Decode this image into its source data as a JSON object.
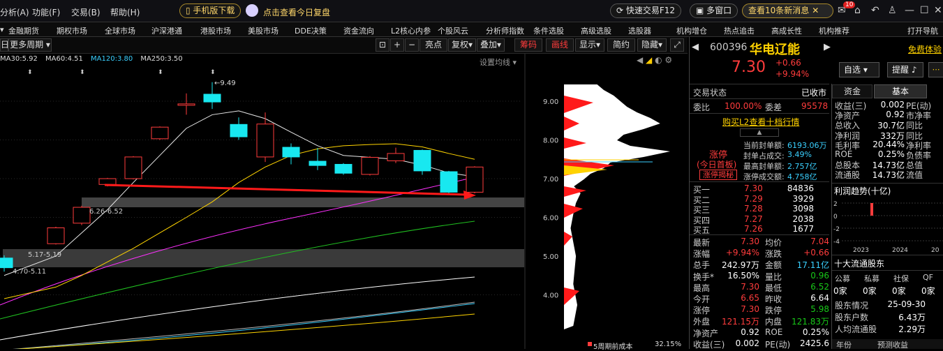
{
  "menu": {
    "items": [
      "分析(A)",
      "功能(F)",
      "交易(B)",
      "帮助(H)"
    ]
  },
  "top": {
    "mobile_btn": "手机版下载",
    "replay_btn": "点击查看今日复盘",
    "quick_trade": "快速交易F12",
    "multi_window": "多窗口",
    "news": "查看10条新消息",
    "news_badge": "10"
  },
  "nav": {
    "items": [
      "金融期货",
      "期权市场",
      "全球市场",
      "沪深港通",
      "港股市场",
      "美股市场",
      "DDE决策",
      "资金流向",
      "L2核心内参",
      "个股风云",
      "分析师指数",
      "条件选股",
      "高级选股",
      "选股器",
      "机构增仓",
      "热点追击",
      "高成长性",
      "机构推荐",
      "打开导航"
    ]
  },
  "toolbar": {
    "period": "日",
    "more_period": "更多周期",
    "buttons": [
      "亮点",
      "复权",
      "叠加",
      "筹码",
      "画线",
      "显示",
      "简约",
      "隐藏"
    ],
    "setting_ma": "设置均线"
  },
  "ma_legend": [
    {
      "label": "MA30:5.92",
      "color": "#f0f0f0"
    },
    {
      "label": "MA60:4.51",
      "color": "#ffffff"
    },
    {
      "label": "MA120:3.80",
      "color": "#3ad0ff"
    },
    {
      "label": "MA250:3.50",
      "color": "#f0f0f0"
    }
  ],
  "chart_data": {
    "type": "candlestick",
    "y_ticks": [
      "9.00",
      "8.00",
      "7.00",
      "6.00",
      "5.00",
      "4.00"
    ],
    "annotations": {
      "high": "9.49",
      "range1": "6.26-6.52",
      "range2": "5.17-5.19",
      "range3": "4.70-5.11"
    },
    "candles": [
      {
        "o": 4.95,
        "c": 4.7,
        "h": 5.02,
        "l": 4.6
      },
      {
        "o": 5.32,
        "c": 5.73,
        "h": 5.76,
        "l": 5.3
      },
      {
        "o": 5.85,
        "c": 6.26,
        "h": 6.3,
        "l": 5.8
      },
      {
        "o": 6.85,
        "c": 7.0,
        "h": 7.02,
        "l": 6.8
      },
      {
        "o": 7.0,
        "c": 7.56,
        "h": 7.58,
        "l": 6.98
      },
      {
        "o": 8.03,
        "c": 8.33,
        "h": 8.35,
        "l": 8.0
      },
      {
        "o": 8.93,
        "c": 8.93,
        "h": 9.2,
        "l": 8.65
      },
      {
        "o": 9.18,
        "c": 8.98,
        "h": 9.49,
        "l": 8.8
      },
      {
        "o": 8.4,
        "c": 8.08,
        "h": 8.58,
        "l": 8.0
      },
      {
        "o": 7.56,
        "c": 8.41,
        "h": 8.71,
        "l": 7.43
      },
      {
        "o": 7.81,
        "c": 7.56,
        "h": 7.91,
        "l": 7.37
      },
      {
        "o": 7.45,
        "c": 7.34,
        "h": 7.79,
        "l": 7.22
      },
      {
        "o": 7.37,
        "c": 7.14,
        "h": 7.4,
        "l": 7.1
      },
      {
        "o": 7.11,
        "c": 7.55,
        "h": 7.58,
        "l": 7.08
      },
      {
        "o": 7.46,
        "c": 7.65,
        "h": 7.8,
        "l": 7.4
      },
      {
        "o": 7.73,
        "c": 7.2,
        "h": 7.75,
        "l": 7.1
      },
      {
        "o": 7.18,
        "c": 6.65,
        "h": 7.2,
        "l": 6.6
      },
      {
        "o": 6.65,
        "c": 7.3,
        "h": 7.32,
        "l": 6.62
      }
    ],
    "ma5": [
      4.5,
      5.0,
      5.6,
      6.2,
      6.9,
      7.6,
      8.3,
      8.65,
      8.75,
      8.55,
      8.2,
      7.85,
      7.6,
      7.55,
      7.5,
      7.35,
      7.15,
      7.05
    ],
    "ma10": [
      3.9,
      4.2,
      4.5,
      4.85,
      5.2,
      5.6,
      6.0,
      6.4,
      6.9,
      7.3,
      7.6,
      7.77,
      7.85,
      7.88,
      7.9,
      7.82,
      7.65,
      7.5
    ]
  },
  "chips": {
    "footer": "5周期前成本",
    "footer_pct": "32.15%"
  },
  "stock": {
    "code": "600396",
    "name": "华电辽能",
    "free_trial": "免费体验",
    "price": "7.30",
    "change": "+0.66",
    "change_pct": "+9.94%",
    "self_select": "自选",
    "remind": "提醒",
    "status_label": "交易状态",
    "status_value": "已收市",
    "wb_label": "委比",
    "wb_value": "100.00%",
    "wc_label": "委差",
    "wc_value": "95578",
    "l2_link": "购买L2查看十档行情",
    "limit_title": "涨停",
    "limit_sub": "(今日首板)",
    "limit_btn": "涨停揭秘",
    "limit_info": [
      {
        "label": "当前封单额:",
        "value": "6193.06万"
      },
      {
        "label": "封单占成交:",
        "value": "3.49%"
      },
      {
        "label": "最高封单额:",
        "value": "2.757亿"
      },
      {
        "label": "涨停成交额:",
        "value": "4.758亿"
      }
    ],
    "bids": [
      {
        "label": "买一",
        "price": "7.30",
        "vol": "84836"
      },
      {
        "label": "买二",
        "price": "7.29",
        "vol": "3929"
      },
      {
        "label": "买三",
        "price": "7.28",
        "vol": "3098"
      },
      {
        "label": "买四",
        "price": "7.27",
        "vol": "2038"
      },
      {
        "label": "买五",
        "price": "7.26",
        "vol": "1677"
      }
    ],
    "stats": [
      {
        "l1": "最新",
        "v1": "7.30",
        "c1": "red",
        "l2": "均价",
        "v2": "7.04",
        "c2": "red"
      },
      {
        "l1": "涨幅",
        "v1": "+9.94%",
        "c1": "red",
        "l2": "涨跌",
        "v2": "+0.66",
        "c2": "red"
      },
      {
        "l1": "总手",
        "v1": "242.97万",
        "c1": "wht",
        "l2": "金额",
        "v2": "17.11亿",
        "c2": "cyan"
      },
      {
        "l1": "换手*",
        "v1": "16.50%",
        "c1": "wht",
        "l2": "量比",
        "v2": "0.96",
        "c2": "grn"
      },
      {
        "l1": "最高",
        "v1": "7.30",
        "c1": "red",
        "l2": "最低",
        "v2": "6.52",
        "c2": "grn"
      },
      {
        "l1": "今开",
        "v1": "6.65",
        "c1": "red",
        "l2": "昨收",
        "v2": "6.64",
        "c2": "wht"
      },
      {
        "l1": "涨停",
        "v1": "7.30",
        "c1": "red",
        "l2": "跌停",
        "v2": "5.98",
        "c2": "grn"
      },
      {
        "l1": "外盘",
        "v1": "121.15万",
        "c1": "red",
        "l2": "内盘",
        "v2": "121.83万",
        "c2": "grn"
      },
      {
        "l1": "净资产",
        "v1": "0.92",
        "c1": "wht",
        "l2": "ROE",
        "v2": "0.25%",
        "c2": "wht"
      },
      {
        "l1": "收益(三)",
        "v1": "0.002",
        "c1": "wht",
        "l2": "PE(动)",
        "v2": "2425.6",
        "c2": "wht"
      }
    ]
  },
  "fund": {
    "tabs": [
      "资金",
      "基本"
    ],
    "rows": [
      {
        "l": "收益(三)",
        "v": "0.002",
        "l2": "PE(动)"
      },
      {
        "l": "净资产",
        "v": "0.92",
        "l2": "市净率"
      },
      {
        "l": "总收入",
        "v": "30.7亿",
        "l2": "同比"
      },
      {
        "l": "净利润",
        "v": "332万",
        "l2": "同比"
      },
      {
        "l": "毛利率",
        "v": "20.44%",
        "l2": "净利率"
      },
      {
        "l": "ROE",
        "v": "0.25%",
        "l2": "负债率"
      },
      {
        "l": "总股本",
        "v": "14.73亿",
        "l2": "总值"
      },
      {
        "l": "流通股",
        "v": "14.73亿",
        "l2": "流值"
      }
    ],
    "profit_title": "利润趋势(十亿)",
    "profit_y": [
      "2",
      "0",
      "-2",
      "-4"
    ],
    "profit_x": [
      "2023",
      "2024",
      "20"
    ],
    "top10_title": "十大流通股东",
    "holder_cols": [
      "公募",
      "私募",
      "社保",
      "QF"
    ],
    "holder_vals": [
      "0家",
      "0家",
      "0家",
      "0家"
    ],
    "holder_rows": [
      {
        "l": "股东情况",
        "v": "25-09-30"
      },
      {
        "l": "股东户数",
        "v": "6.43万"
      },
      {
        "l": "人均流通股",
        "v": "2.29万"
      }
    ],
    "bottom_tabs": [
      "年份",
      "预测收益"
    ]
  }
}
